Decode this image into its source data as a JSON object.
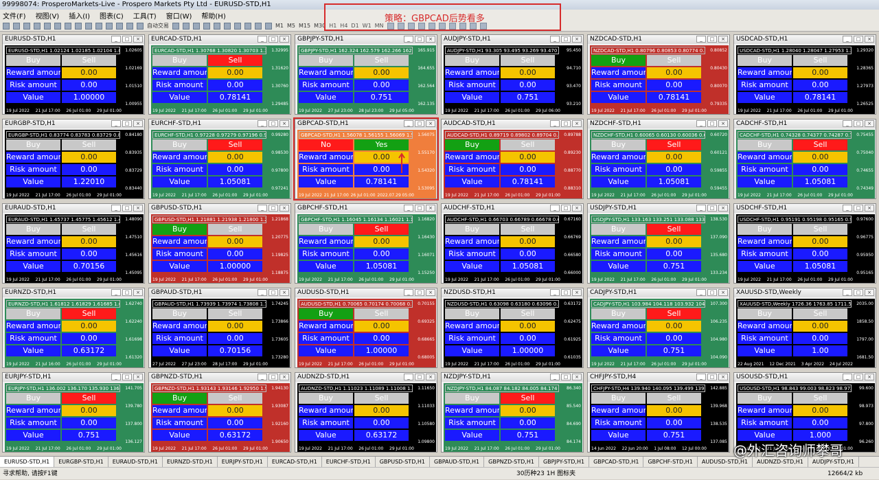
{
  "window_title": "99998074: ProsperoMarkets-Live - Prospero Markets Pty Ltd - EURUSD-STD,H1",
  "menu": [
    "文件(F)",
    "视图(V)",
    "插入(I)",
    "图表(C)",
    "工具(T)",
    "窗口(W)",
    "帮助(H)"
  ],
  "toolbar": {
    "autotrade": "自动交易",
    "new_order": "新订单",
    "timeframes": [
      "M1",
      "M5",
      "M15",
      "M30",
      "H1",
      "H4",
      "D1",
      "W1",
      "MN"
    ]
  },
  "strategy_note": "策略：GBPCAD后势看多",
  "labels": {
    "buy": "Buy",
    "sell": "Sell",
    "reward": "Reward amount",
    "risk": "Risk amount",
    "value": "Value",
    "no": "No",
    "yes": "Yes"
  },
  "colors": {
    "bg_green": "#2e8b57",
    "bg_red": "#c0302a",
    "bg_black": "#000000",
    "bg_orange": "#f07e3c",
    "btn_buy_green": "#13a013",
    "btn_sell_red": "#ff1a1a",
    "input_yellow": "#f5c400",
    "label_blue": "#1a1aff"
  },
  "windows": [
    {
      "title": "EURUSD-STD,H1",
      "bg": "black",
      "buy": "grey",
      "sell": "grey",
      "reward": "0.00",
      "risk": "0.00",
      "value": "1.00000",
      "hdr": "EURUSD-STD,H1 1.02124 1.02185 1.02104 1.02106",
      "prices": [
        "1.02605",
        "1.02169",
        "1.01510",
        "1.00955"
      ],
      "dates": [
        "19 Jul 2022",
        "21 Jul 17:00",
        "26 Jul 01:00",
        "29 Jul 01:00"
      ]
    },
    {
      "title": "EURCAD-STD,H1",
      "bg": "green",
      "buy": "grey",
      "sell": "red",
      "reward": "0.00",
      "risk": "0.00",
      "value": "0.78141",
      "hdr": "EURCAD-STD,H1 1.30768 1.30820 1.30703 1.30760",
      "prices": [
        "1.32995",
        "1.31620",
        "1.30760",
        "1.29485"
      ],
      "dates": [
        "19 Jul 2022",
        "21 Jul 17:00",
        "26 Jul 01:00",
        "29 Jul 01:00"
      ]
    },
    {
      "title": "GBPJPY-STD,H1",
      "bg": "green",
      "buy": "grey",
      "sell": "grey",
      "reward": "0.00",
      "risk": "0.00",
      "value": "0.751",
      "hdr": "GBPJPY-STD,H1 162.324 162.579 162.266 162.564",
      "prices": [
        "165.915",
        "164.655",
        "162.564",
        "162.135"
      ],
      "dates": [
        "19 Jul 2022",
        "27 Jul 23:00",
        "28 Jul 23:00",
        "29 Jul 05:00"
      ]
    },
    {
      "title": "AUDJPY-STD,H1",
      "bg": "black",
      "buy": "grey",
      "sell": "grey",
      "reward": "0.00",
      "risk": "0.00",
      "value": "0.751",
      "hdr": "AUDJPY-STD,H1 93.305 93.495 93.269 93.470",
      "prices": [
        "95.450",
        "94.710",
        "93.470",
        "93.210"
      ],
      "dates": [
        "19 Jul 2022",
        "21 Jul 17:00",
        "26 Jul 01:00",
        "29 Jul 06:00"
      ]
    },
    {
      "title": "NZDCAD-STD,H1",
      "bg": "red",
      "buy": "green",
      "sell": "grey",
      "reward": "0.00",
      "risk": "0.00",
      "value": "0.78141",
      "hdr": "NZDCAD-STD,H1 0.80796 0.80853 0.80774 0.80852",
      "prices": [
        "0.80852",
        "0.80430",
        "0.80070",
        "0.79335"
      ],
      "dates": [
        "19 Jul 2022",
        "21 Jul 17:00",
        "26 Jul 01:00",
        "29 Jul 01:00"
      ]
    },
    {
      "title": "USDCAD-STD,H1",
      "bg": "black",
      "buy": "grey",
      "sell": "grey",
      "reward": "0.00",
      "risk": "0.00",
      "value": "0.78141",
      "hdr": "USDCAD-STD,H1 1.28040 1.28047 1.27953 1.27973",
      "prices": [
        "1.29320",
        "1.28365",
        "1.27973",
        "1.26525"
      ],
      "dates": [
        "19 Jul 2022",
        "21 Jul 17:00",
        "26 Jul 01:00",
        "29 Jul 01:00"
      ]
    },
    {
      "title": "EURGBP-STD,H1",
      "bg": "black",
      "buy": "grey",
      "sell": "grey",
      "reward": "0.00",
      "risk": "0.00",
      "value": "1.22010",
      "hdr": "EURGBP-STD,H1 0.83774 0.83783 0.83729 0.83729",
      "prices": [
        "0.84180",
        "0.83935",
        "0.83729",
        "0.83440"
      ],
      "dates": [
        "19 Jul 2022",
        "21 Jul 17:00",
        "26 Jul 01:00",
        "29 Jul 01:00"
      ]
    },
    {
      "title": "EURCHF-STD,H1",
      "bg": "green",
      "buy": "grey",
      "sell": "red",
      "reward": "0.00",
      "risk": "0.00",
      "value": "1.05081",
      "hdr": "EURCHF-STD,H1 0.97228 0.97279 0.97196 0.97241",
      "prices": [
        "0.99280",
        "0.98530",
        "0.97800",
        "0.97241"
      ],
      "dates": [
        "19 Jul 2022",
        "21 Jul 17:00",
        "26 Jul 01:00",
        "29 Jul 01:00"
      ]
    },
    {
      "title": "GBPCAD-STD,H1",
      "bg": "orange",
      "buy": "grey",
      "sell": "grey",
      "reward": "0.00",
      "risk": "0.00",
      "value": "0.78141",
      "hdr": "GBPCAD-STD,H1 1.56078 1.56155 1.56069 1.56075",
      "prices": [
        "1.56075",
        "1.55170",
        "1.54320",
        "1.53095"
      ],
      "dates": [
        "19 Jul 2022",
        "21 Jul 17:00",
        "26 Jul 01:00",
        "2022.07.29 05:00"
      ],
      "confirm": true
    },
    {
      "title": "AUDCAD-STD,H1",
      "bg": "red",
      "buy": "green",
      "sell": "grey",
      "reward": "0.00",
      "risk": "0.00",
      "value": "0.78141",
      "hdr": "AUDCAD-STD,H1 0.89719 0.89802 0.89704 0.89788",
      "prices": [
        "0.89788",
        "0.89230",
        "0.88770",
        "0.88310"
      ],
      "dates": [
        "19 Jul 2022",
        "21 Jul 17:00",
        "26 Jul 01:00",
        "29 Jul 01:00"
      ]
    },
    {
      "title": "NZDCHF-STD,H1",
      "bg": "green",
      "buy": "grey",
      "sell": "red",
      "reward": "0.00",
      "risk": "0.00",
      "value": "1.05081",
      "hdr": "NZDCHF-STD,H1 0.60065 0.60130 0.60036 0.60121",
      "prices": [
        "0.60720",
        "0.60121",
        "0.59855",
        "0.59455"
      ],
      "dates": [
        "19 Jul 2022",
        "21 Jul 17:00",
        "26 Jul 01:00",
        "29 Jul 01:00"
      ]
    },
    {
      "title": "CADCHF-STD,H1",
      "bg": "green",
      "buy": "grey",
      "sell": "red",
      "reward": "0.00",
      "risk": "0.00",
      "value": "1.05081",
      "hdr": "CADCHF-STD,H1 0.74328 0.74377 0.74287 0.74349",
      "prices": [
        "0.75455",
        "0.75040",
        "0.74655",
        "0.74349"
      ],
      "dates": [
        "19 Jul 2022",
        "21 Jul 17:00",
        "26 Jul 01:00",
        "29 Jul 01:00"
      ]
    },
    {
      "title": "EURAUD-STD,H1",
      "bg": "black",
      "buy": "grey",
      "sell": "grey",
      "reward": "0.00",
      "risk": "0.00",
      "value": "0.70156",
      "hdr": "EURAUD-STD,H1 1.45737 1.45775 1.45612 1.45616",
      "prices": [
        "1.48090",
        "1.47510",
        "1.45616",
        "1.45095"
      ],
      "dates": [
        "19 Jul 2022",
        "21 Jul 17:00",
        "26 Jul 01:00",
        "29 Jul 01:00"
      ]
    },
    {
      "title": "GBPUSD-STD,H1",
      "bg": "red",
      "buy": "green",
      "sell": "grey",
      "reward": "0.00",
      "risk": "0.00",
      "value": "1.00000",
      "hdr": "GBPUSD-STD,H1 1.21881 1.21938 1.21800 1.21868",
      "prices": [
        "1.21868",
        "1.20775",
        "1.19825",
        "1.18875"
      ],
      "dates": [
        "19 Jul 2022",
        "21 Jul 17:00",
        "26 Jul 01:00",
        "29 Jul 01:00"
      ]
    },
    {
      "title": "GBPCHF-STD,H1",
      "bg": "green",
      "buy": "grey",
      "sell": "red",
      "reward": "0.00",
      "risk": "0.00",
      "value": "1.05081",
      "hdr": "GBPCHF-STD,H1 1.16045 1.16134 1.16021 1.16071",
      "prices": [
        "1.16820",
        "1.16430",
        "1.16071",
        "1.15250"
      ],
      "dates": [
        "19 Jul 2022",
        "21 Jul 17:00",
        "26 Jul 01:00",
        "29 Jul 01:00"
      ]
    },
    {
      "title": "AUDCHF-STD,H1",
      "bg": "black",
      "buy": "grey",
      "sell": "grey",
      "reward": "0.00",
      "risk": "0.00",
      "value": "1.05081",
      "hdr": "AUDCHF-STD,H1 0.66703 0.66789 0.66678 0.66769",
      "prices": [
        "0.67160",
        "0.66769",
        "0.66580",
        "0.66000"
      ],
      "dates": [
        "19 Jul 2022",
        "21 Jul 17:00",
        "26 Jul 01:00",
        "29 Jul 01:00"
      ]
    },
    {
      "title": "USDJPY-STD,H1",
      "bg": "green",
      "buy": "grey",
      "sell": "red",
      "reward": "0.00",
      "risk": "0.00",
      "value": "0.751",
      "hdr": "USDJPY-STD,H1 133.163 133.251 133.088 133.234",
      "prices": [
        "138.530",
        "137.090",
        "135.680",
        "133.234"
      ],
      "dates": [
        "19 Jul 2022",
        "21 Jul 17:00",
        "26 Jul 01:00",
        "29 Jul 01:00"
      ]
    },
    {
      "title": "USDCHF-STD,H1",
      "bg": "black",
      "buy": "grey",
      "sell": "grey",
      "reward": "0.00",
      "risk": "0.00",
      "value": "1.05081",
      "hdr": "USDCHF-STD,H1 0.95191 0.95198 0.95165 0.95165",
      "prices": [
        "0.97600",
        "0.96775",
        "0.95950",
        "0.95165"
      ],
      "dates": [
        "19 Jul 2022",
        "21 Jul 17:00",
        "26 Jul 01:00",
        "29 Jul 01:00"
      ]
    },
    {
      "title": "EURNZD-STD,H1",
      "bg": "green",
      "buy": "grey",
      "sell": "red",
      "reward": "0.00",
      "risk": "0.00",
      "value": "0.63172",
      "hdr": "EURNZD-STD,H1 1.61812 1.61829 1.61685 1.61698",
      "prices": [
        "1.62740",
        "1.62240",
        "1.61698",
        "1.61320"
      ],
      "dates": [
        "19 Jul 2022",
        "21 Jul 16:00",
        "26 Jul 01:00",
        "29 Jul 01:00"
      ]
    },
    {
      "title": "GBPAUD-STD,H1",
      "bg": "black",
      "buy": "grey",
      "sell": "grey",
      "reward": "0.00",
      "risk": "0.00",
      "value": "0.70156",
      "hdr": "GBPAUD-STD,H1 1.73939 1.73974 1.73808 1.73866",
      "prices": [
        "1.74245",
        "1.73866",
        "1.73605",
        "1.73280"
      ],
      "dates": [
        "27 Jul 2022",
        "27 Jul 23:00",
        "28 Jul 17:00",
        "29 Jul 01:00"
      ]
    },
    {
      "title": "AUDUSD-STD,H1",
      "bg": "red",
      "buy": "green",
      "sell": "grey",
      "reward": "0.00",
      "risk": "0.00",
      "value": "1.00000",
      "hdr": "AUDUSD-STD,H1 0.70065 0.70174 0.70068 0.70155",
      "prices": [
        "0.70155",
        "0.69325",
        "0.68665",
        "0.68005"
      ],
      "dates": [
        "19 Jul 2022",
        "21 Jul 17:00",
        "26 Jul 01:00",
        "29 Jul 01:00"
      ]
    },
    {
      "title": "NZDUSD-STD,H1",
      "bg": "black",
      "buy": "grey",
      "sell": "grey",
      "reward": "0.00",
      "risk": "0.00",
      "value": "1.00000",
      "hdr": "NZDUSD-STD,H1 0.63098 0.63180 0.63096 0.63172",
      "prices": [
        "0.63172",
        "0.62475",
        "0.61925",
        "0.61035"
      ],
      "dates": [
        "19 Jul 2022",
        "21 Jul 17:00",
        "26 Jul 01:00",
        "29 Jul 01:00"
      ]
    },
    {
      "title": "CADJPY-STD,H1",
      "bg": "green",
      "buy": "grey",
      "sell": "red",
      "reward": "0.00",
      "risk": "0.00",
      "value": "0.751",
      "hdr": "CADJPY-STD,H1 103.984 104.118 103.932 104.090",
      "prices": [
        "107.300",
        "106.235",
        "104.980",
        "104.090"
      ],
      "dates": [
        "19 Jul 2022",
        "21 Jul 17:00",
        "26 Jul 01:00",
        "29 Jul 01:00"
      ]
    },
    {
      "title": "XAUUSD-STD,Weekly",
      "bg": "black",
      "buy": "grey",
      "sell": "grey",
      "reward": "0.00",
      "risk": "0.00",
      "value": "1.00",
      "hdr": "XAUUSD-STD,Weekly 1726.36 1763.85 1711.55 1752.39",
      "prices": [
        "2035.00",
        "1858.50",
        "1797.00",
        "1681.50"
      ],
      "dates": [
        "22 Aug 2021",
        "12 Dec 2021",
        "3 Apr 2022",
        "24 Jul 2022"
      ]
    },
    {
      "title": "EURJPY-STD,H1",
      "bg": "green",
      "buy": "grey",
      "sell": "red",
      "reward": "0.00",
      "risk": "0.00",
      "value": "0.751",
      "hdr": "EURJPY-STD,H1 136.002 136.170 135.930 136.127",
      "prices": [
        "141.705",
        "139.780",
        "137.800",
        "136.127"
      ],
      "dates": [
        "19 Jul 2022",
        "21 Jul 17:00",
        "26 Jul 01:00",
        "29 Jul 01:00"
      ]
    },
    {
      "title": "GBPNZD-STD,H1",
      "bg": "red",
      "buy": "green",
      "sell": "grey",
      "reward": "0.00",
      "risk": "0.00",
      "value": "0.63172",
      "hdr": "GBPNZD-STD,H1 1.93143 1.93146 1.92950 1.93087",
      "prices": [
        "1.94130",
        "1.93087",
        "1.92160",
        "1.90650"
      ],
      "dates": [
        "19 Jul 2022",
        "21 Jul 17:00",
        "26 Jul 01:00",
        "29 Jul 01:00"
      ]
    },
    {
      "title": "AUDNZD-STD,H1",
      "bg": "black",
      "buy": "grey",
      "sell": "grey",
      "reward": "0.00",
      "risk": "0.00",
      "value": "0.63172",
      "hdr": "AUDNZD-STD,H1 1.11023 1.11089 1.11008 1.11033",
      "prices": [
        "1.11650",
        "1.11033",
        "1.10580",
        "1.09800"
      ],
      "dates": [
        "19 Jul 2022",
        "21 Jul 17:00",
        "26 Jul 01:00",
        "29 Jul 01:00"
      ]
    },
    {
      "title": "NZDJPY-STD,H1",
      "bg": "green",
      "buy": "grey",
      "sell": "red",
      "reward": "0.00",
      "risk": "0.00",
      "value": "0.751",
      "hdr": "NZDJPY-STD,H1 84.087 84.182 84.005 84.174",
      "prices": [
        "86.340",
        "85.540",
        "84.690",
        "84.174"
      ],
      "dates": [
        "19 Jul 2022",
        "21 Jul 17:00",
        "26 Jul 01:00",
        "29 Jul 01:00"
      ]
    },
    {
      "title": "CHFJPY-STD,H4",
      "bg": "black",
      "buy": "grey",
      "sell": "grey",
      "reward": "0.00",
      "risk": "0.00",
      "value": "0.751",
      "hdr": "CHFJPY-STD,H4 139.940 140.095 139.499 139.968",
      "prices": [
        "142.885",
        "139.968",
        "138.535",
        "137.085"
      ],
      "dates": [
        "14 Jun 2022",
        "22 Jun 20:00",
        "1 Jul 08:00",
        "12 Jul 00:00"
      ]
    },
    {
      "title": "USOUSD-STD,H1",
      "bg": "black",
      "buy": "grey",
      "sell": "grey",
      "reward": "0.00",
      "risk": "0.00",
      "value": "1.000",
      "hdr": "USOUSD-STD,H1 98.843 99.003 98.823 98.973",
      "prices": [
        "99.600",
        "98.973",
        "97.800",
        "96.260"
      ],
      "dates": [
        "19 Jul 2022",
        "21 Jul 17:00",
        "26 Jul 01:00",
        "29 Jul 01:00"
      ]
    }
  ],
  "tabs": [
    "EURUSD-STD,H1",
    "EURGBP-STD,H1",
    "EURAUD-STD,H1",
    "EURNZD-STD,H1",
    "EURJPY-STD,H1",
    "EURCAD-STD,H1",
    "EURCHF-STD,H1",
    "GBPUSD-STD,H1",
    "GBPAUD-STD,H1",
    "GBPNZD-STD,H1",
    "GBPJPY-STD,H1",
    "GBPCAD-STD,H1",
    "GBPCHF-STD,H1",
    "AUDUSD-STD,H1",
    "AUDNZD-STD,H1",
    "AUDJPY-STD,H1"
  ],
  "status": {
    "help": "寻求帮助, 请按F1键",
    "bars": "30历种23 1H 图标夹",
    "traffic": "12664/2 kb"
  },
  "watermark": "@外汇咨询师攀哥"
}
